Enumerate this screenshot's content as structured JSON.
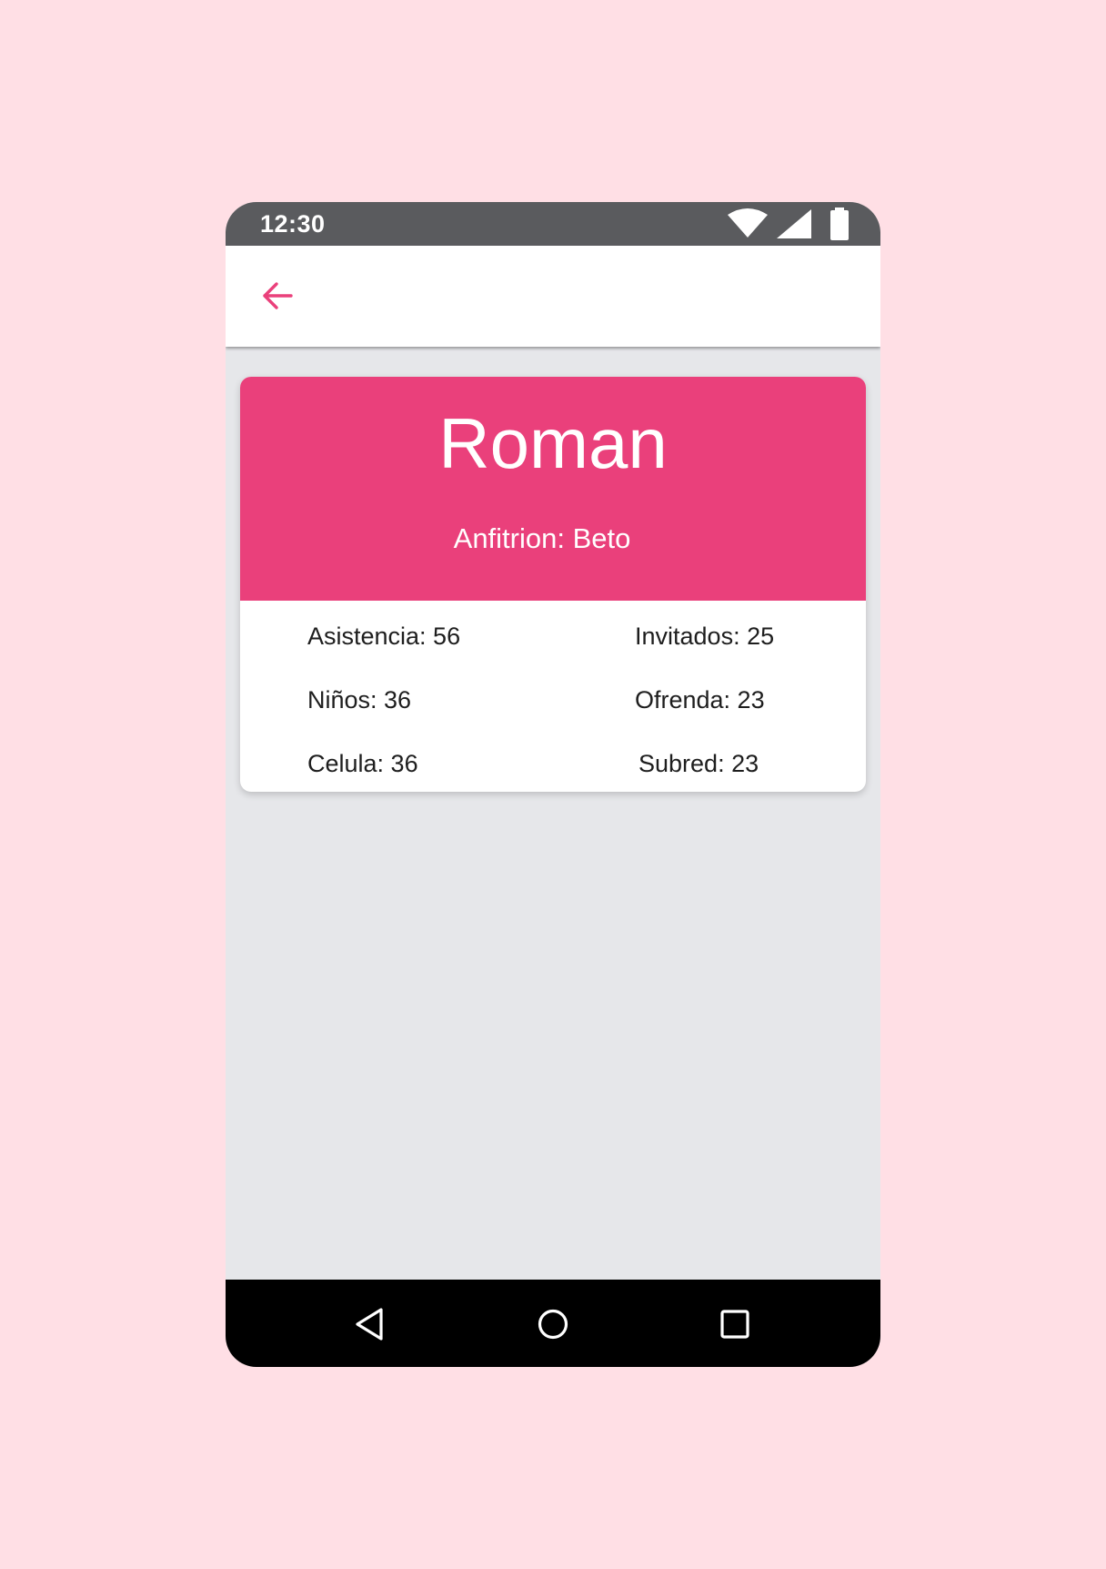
{
  "status_bar": {
    "time": "12:30",
    "icons": [
      "wifi-icon",
      "cell-signal-icon",
      "battery-icon"
    ]
  },
  "app_bar": {
    "back_icon": "arrow-back-icon",
    "accent_color": "#ea407b"
  },
  "card": {
    "title": "Roman",
    "subtitle": "Anfitrion: Beto",
    "header_color": "#ea407b",
    "stats": {
      "asistencia": "Asistencia: 56",
      "invitados": "Invitados: 25",
      "ninos": "Niños: 36",
      "ofrenda": "Ofrenda: 23",
      "celula": "Celula: 36",
      "subred": "Subred: 23"
    }
  },
  "nav_bar": {
    "icons": [
      "back-triangle-icon",
      "home-circle-icon",
      "recents-square-icon"
    ]
  }
}
